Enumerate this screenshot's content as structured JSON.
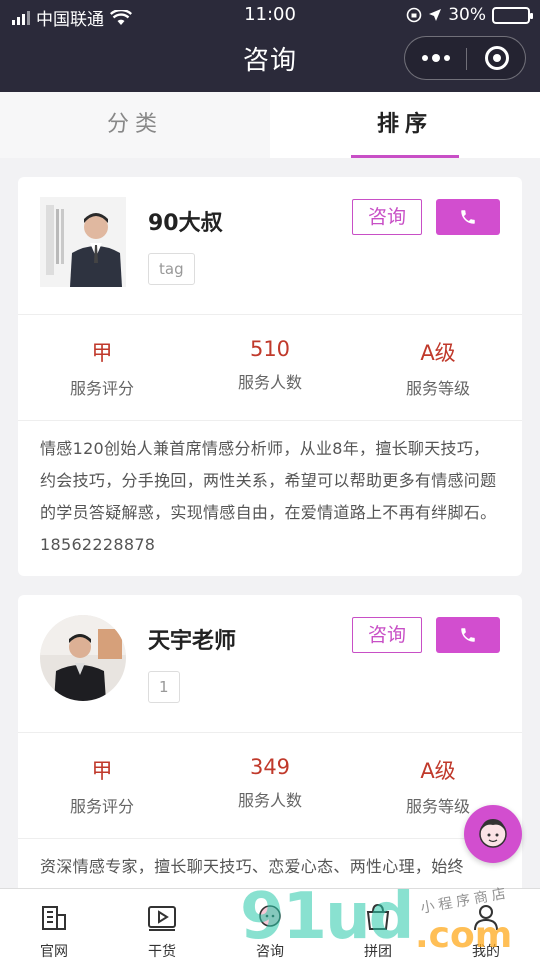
{
  "status_bar": {
    "carrier": "中国联通",
    "time": "11:00",
    "battery": "30%",
    "battery_level": 0.3
  },
  "nav": {
    "title": "咨询"
  },
  "tabs": [
    {
      "label": "分类"
    },
    {
      "label": "排序"
    }
  ],
  "active_tab": "排序",
  "cards": [
    {
      "name": "90大叔",
      "tag": "tag",
      "consult_label": "咨询",
      "stats": [
        {
          "value": "甲",
          "label": "服务评分"
        },
        {
          "value": "510",
          "label": "服务人数"
        },
        {
          "value": "A级",
          "label": "服务等级"
        }
      ],
      "description": "情感120创始人兼首席情感分析师，从业8年，擅长聊天技巧，约会技巧，分手挽回，两性关系，希望可以帮助更多有情感问题的学员答疑解惑，实现情感自由，在爱情道路上不再有绊脚石。18562228878"
    },
    {
      "name": "天宇老师",
      "tag": "1",
      "consult_label": "咨询",
      "stats": [
        {
          "value": "甲",
          "label": "服务评分"
        },
        {
          "value": "349",
          "label": "服务人数"
        },
        {
          "value": "A级",
          "label": "服务等级"
        }
      ],
      "description": "资深情感专家，擅长聊天技巧、恋爱心态、两性心理，始终"
    }
  ],
  "tabbar": [
    {
      "label": "官网",
      "icon": "building-icon"
    },
    {
      "label": "干货",
      "icon": "video-icon"
    },
    {
      "label": "咨询",
      "icon": "chat-icon"
    },
    {
      "label": "拼团",
      "icon": "bag-icon"
    },
    {
      "label": "我的",
      "icon": "user-icon"
    }
  ],
  "watermark": {
    "text": "91ud",
    "suffix": ".com",
    "caption": "小程序商店"
  },
  "colors": {
    "header_bg": "#2b2a3a",
    "accent": "#d24ecf",
    "stat_value": "#c0392b"
  }
}
